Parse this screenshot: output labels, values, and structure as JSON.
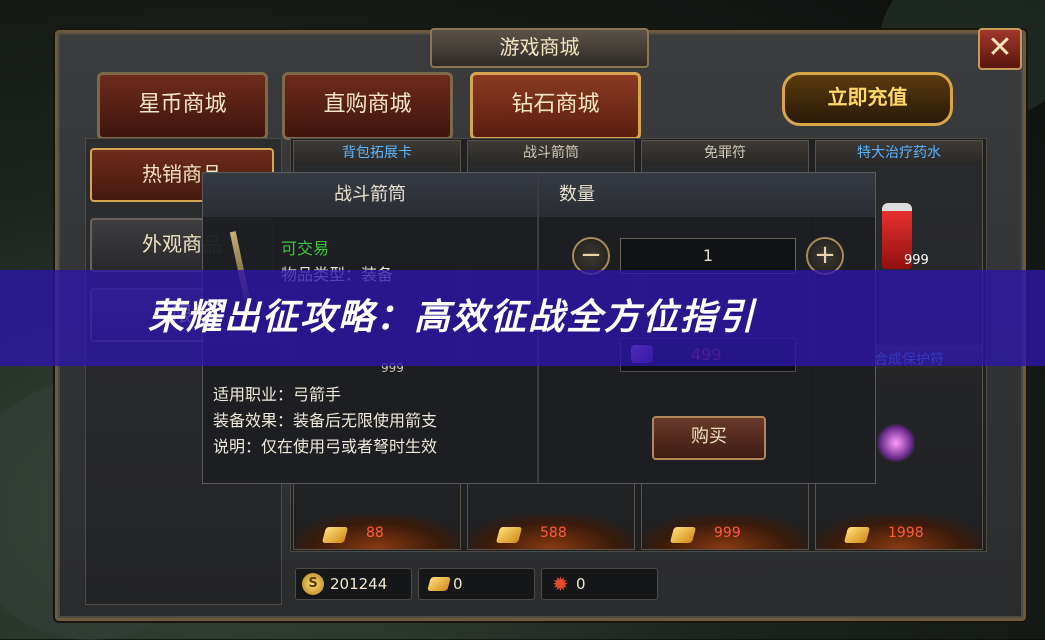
{
  "window": {
    "title": "游戏商城",
    "close_label": "✕"
  },
  "top_tabs": [
    {
      "label": "星币商城"
    },
    {
      "label": "直购商城"
    },
    {
      "label": "钻石商城"
    }
  ],
  "recharge_label": "立即充值",
  "side_tabs": [
    {
      "label": "热销商品"
    },
    {
      "label": "外观商品"
    },
    {
      "label": "限"
    }
  ],
  "cards": [
    {
      "title": "背包拓展卡",
      "price": "88"
    },
    {
      "title": "战斗箭筒",
      "price": "588"
    },
    {
      "title": "免罪符",
      "price": "999"
    },
    {
      "title": "特大治疗药水",
      "price": "1998",
      "count": "999",
      "lower_title": "合成保护符"
    }
  ],
  "currencies": [
    {
      "icon": "s-coin-icon",
      "value": "201244"
    },
    {
      "icon": "gold-gem-icon",
      "value": "0"
    },
    {
      "icon": "red-star-gem-icon",
      "value": "0"
    }
  ],
  "popup": {
    "item_name": "战斗箭筒",
    "tradeable": "可交易",
    "item_type": "物品类型：装备",
    "count_label": "999",
    "profession": "适用职业：弓箭手",
    "effect": "装备效果：装备后无限使用箭支",
    "description": "说明：仅在使用弓或者弩时生效",
    "qty_header": "数量",
    "qty_value": "1",
    "price": "499",
    "buy_label": "购买"
  },
  "banner": {
    "text": "荣耀出征攻略：高效征战全方位指引"
  },
  "colors": {
    "accent_gold": "#d6a552",
    "price_red": "#ff5a3a",
    "banner_blue": "#2d14aa",
    "tradeable_green": "#3cc83c"
  }
}
